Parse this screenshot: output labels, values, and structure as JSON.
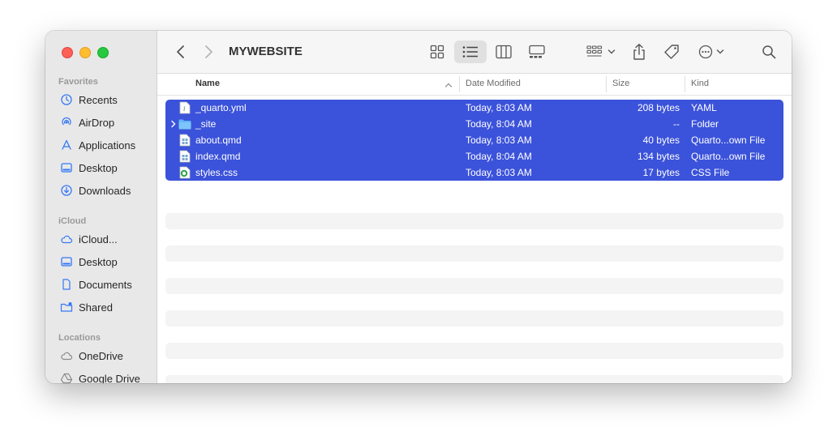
{
  "window": {
    "title": "MYWEBSITE"
  },
  "sidebar": {
    "sections": [
      {
        "label": "Favorites",
        "items": [
          {
            "label": "Recents",
            "icon": "clock-icon"
          },
          {
            "label": "AirDrop",
            "icon": "airdrop-icon"
          },
          {
            "label": "Applications",
            "icon": "applications-icon"
          },
          {
            "label": "Desktop",
            "icon": "desktop-icon"
          },
          {
            "label": "Downloads",
            "icon": "downloads-icon"
          }
        ]
      },
      {
        "label": "iCloud",
        "items": [
          {
            "label": "iCloud...",
            "icon": "cloud-icon"
          },
          {
            "label": "Desktop",
            "icon": "desktop-icon"
          },
          {
            "label": "Documents",
            "icon": "document-icon"
          },
          {
            "label": "Shared",
            "icon": "shared-folder-icon"
          }
        ]
      },
      {
        "label": "Locations",
        "items": [
          {
            "label": "OneDrive",
            "icon": "cloud-icon"
          },
          {
            "label": "Google Drive",
            "icon": "google-drive-icon"
          }
        ]
      }
    ]
  },
  "columns": {
    "name": "Name",
    "date": "Date Modified",
    "size": "Size",
    "kind": "Kind"
  },
  "files": [
    {
      "name": "_quarto.yml",
      "date": "Today, 8:03 AM",
      "size": "208 bytes",
      "kind": "YAML",
      "icon": "yaml-file-icon"
    },
    {
      "name": "_site",
      "date": "Today, 8:04 AM",
      "size": "--",
      "kind": "Folder",
      "icon": "folder-icon"
    },
    {
      "name": "about.qmd",
      "date": "Today, 8:03 AM",
      "size": "40 bytes",
      "kind": "Quarto...own File",
      "icon": "quarto-file-icon"
    },
    {
      "name": "index.qmd",
      "date": "Today, 8:04 AM",
      "size": "134 bytes",
      "kind": "Quarto...own File",
      "icon": "quarto-file-icon"
    },
    {
      "name": "styles.css",
      "date": "Today, 8:03 AM",
      "size": "17 bytes",
      "kind": "CSS File",
      "icon": "css-file-icon"
    }
  ],
  "colors": {
    "selection": "#3b52da",
    "accent": "#3478f6"
  }
}
